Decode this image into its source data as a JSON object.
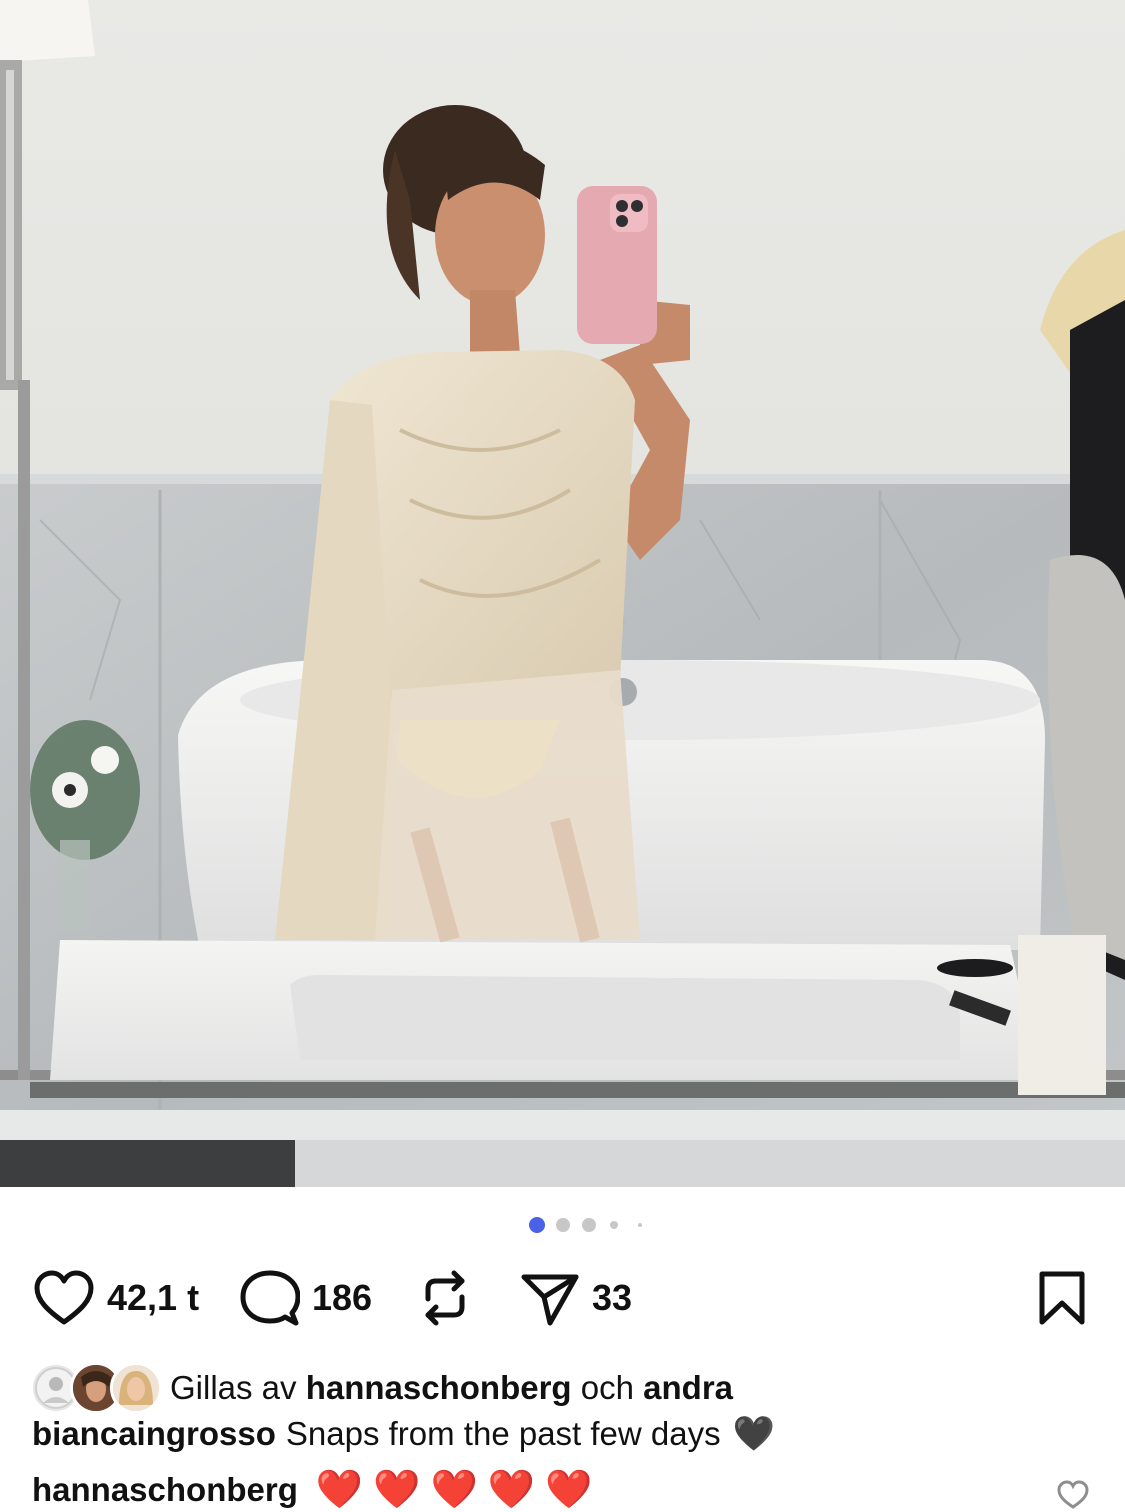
{
  "post": {
    "carousel": {
      "count": 5,
      "active_index": 0
    },
    "likes": "42,1 t",
    "comments": "186",
    "shares": "33",
    "liked_by_prefix": "Gillas av",
    "liked_by_user": "hannaschonberg",
    "liked_by_joiner": "och",
    "liked_by_others": "andra",
    "author": "biancaingrosso",
    "caption": "Snaps from the past few days",
    "caption_emoji": "🖤",
    "first_comment_user": "hannaschonberg",
    "first_comment_text": "❤️❤️❤️❤️❤️"
  },
  "colors": {
    "accent": "#4a61e8",
    "heart_red": "#e8263f"
  },
  "icons": {
    "like": "heart-outline-icon",
    "comment": "speech-bubble-icon",
    "repost": "repost-icon",
    "share": "paper-plane-icon",
    "save": "bookmark-icon"
  }
}
